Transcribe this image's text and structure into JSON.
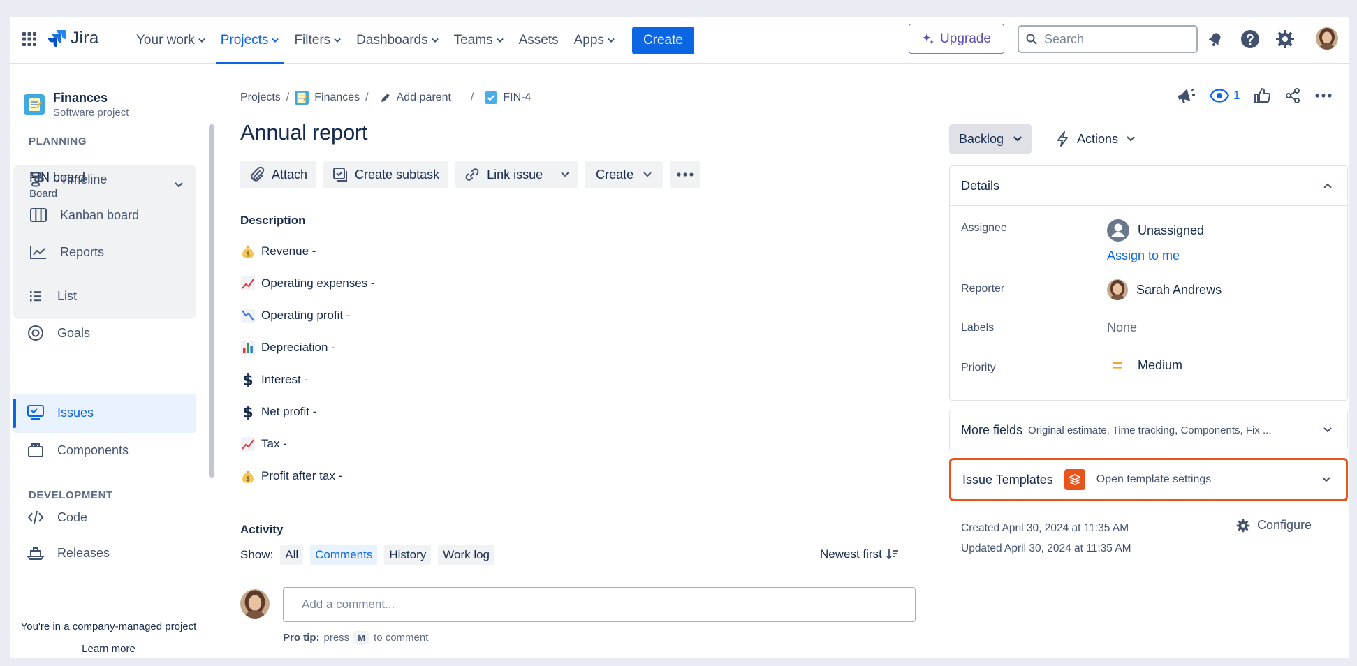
{
  "app": {
    "name": "Jira"
  },
  "topnav": {
    "items": [
      {
        "label": "Your work",
        "dropdown": true
      },
      {
        "label": "Projects",
        "dropdown": true,
        "active": true
      },
      {
        "label": "Filters",
        "dropdown": true
      },
      {
        "label": "Dashboards",
        "dropdown": true
      },
      {
        "label": "Teams",
        "dropdown": true
      },
      {
        "label": "Assets",
        "dropdown": false
      },
      {
        "label": "Apps",
        "dropdown": true
      }
    ],
    "create_label": "Create",
    "upgrade_label": "Upgrade",
    "search_placeholder": "Search"
  },
  "sidebar": {
    "project_name": "Finances",
    "project_type": "Software project",
    "planning_label": "PLANNING",
    "board": {
      "name": "FIN board",
      "sub": "Board"
    },
    "planning_items": [
      {
        "label": "Timeline",
        "icon": "timeline-icon"
      },
      {
        "label": "Kanban board",
        "icon": "kanban-icon"
      },
      {
        "label": "Reports",
        "icon": "reports-icon"
      }
    ],
    "items": [
      {
        "label": "List",
        "icon": "list-icon"
      },
      {
        "label": "Goals",
        "icon": "goals-icon"
      },
      {
        "label": "Issues",
        "icon": "issues-icon",
        "active": true
      },
      {
        "label": "Components",
        "icon": "components-icon"
      }
    ],
    "development_label": "DEVELOPMENT",
    "dev_items": [
      {
        "label": "Code",
        "icon": "code-icon"
      },
      {
        "label": "Releases",
        "icon": "releases-icon"
      }
    ],
    "footer_text": "You're in a company-managed project",
    "footer_link": "Learn more"
  },
  "breadcrumb": {
    "projects": "Projects",
    "project": "Finances",
    "add_parent": "Add parent",
    "issue_key": "FIN-4"
  },
  "issue": {
    "title": "Annual report",
    "toolbar": {
      "attach": "Attach",
      "create_subtask": "Create subtask",
      "link_issue": "Link issue",
      "create": "Create"
    },
    "description_label": "Description",
    "description_lines": [
      {
        "icon": "money-bag-icon",
        "text": "Revenue -"
      },
      {
        "icon": "chart-increasing-icon",
        "text": "Operating expenses -"
      },
      {
        "icon": "chart-decreasing-icon",
        "text": "Operating profit -"
      },
      {
        "icon": "bar-chart-icon",
        "text": "Depreciation -"
      },
      {
        "icon": "dollar-sign-icon",
        "text": "Interest -"
      },
      {
        "icon": "dollar-sign-icon",
        "text": "Net profit -"
      },
      {
        "icon": "chart-increasing-icon",
        "text": "Tax -"
      },
      {
        "icon": "money-bag-icon",
        "text": "Profit after tax -"
      }
    ],
    "activity": {
      "label": "Activity",
      "show_label": "Show:",
      "filters": [
        "All",
        "Comments",
        "History",
        "Work log"
      ],
      "active_filter": "Comments",
      "sort_label": "Newest first",
      "comment_placeholder": "Add a comment...",
      "protip_bold": "Pro tip:",
      "protip_text_1": "press",
      "protip_key": "M",
      "protip_text_2": "to comment"
    }
  },
  "right": {
    "watch_count": "1",
    "status": "Backlog",
    "actions_label": "Actions",
    "details_label": "Details",
    "fields": {
      "assignee_label": "Assignee",
      "assignee_value": "Unassigned",
      "assign_to_me": "Assign to me",
      "reporter_label": "Reporter",
      "reporter_value": "Sarah Andrews",
      "labels_label": "Labels",
      "labels_value": "None",
      "priority_label": "Priority",
      "priority_value": "Medium"
    },
    "more_fields_title": "More fields",
    "more_fields_sub": "Original estimate, Time tracking, Components, Fix ...",
    "templates_title": "Issue Templates",
    "templates_link": "Open template settings",
    "created": "Created April 30, 2024 at 11:35 AM",
    "updated": "Updated April 30, 2024 at 11:35 AM",
    "configure": "Configure"
  },
  "colors": {
    "brand_blue": "#0c66e4",
    "upgrade_purple": "#5e4db2",
    "highlight_orange": "#e8541b",
    "priority_medium": "#f5a623"
  }
}
